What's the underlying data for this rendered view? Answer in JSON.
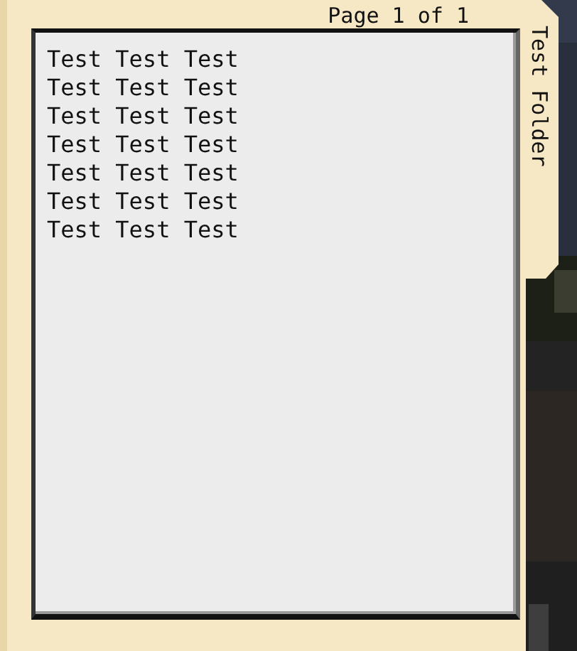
{
  "folder": {
    "tab_label": "Test Folder",
    "page_indicator": "Page 1 of 1"
  },
  "page": {
    "lines": [
      "Test Test Test",
      "Test Test Test",
      "Test Test Test",
      "Test Test Test",
      "Test Test Test",
      "Test Test Test",
      "Test Test Test"
    ]
  }
}
